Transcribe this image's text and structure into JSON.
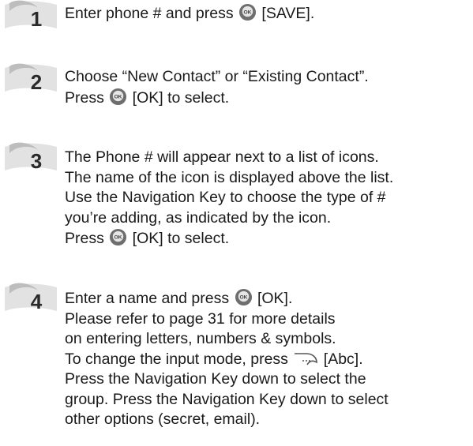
{
  "steps": [
    {
      "number": "1",
      "lines": [
        {
          "before": "Enter phone # and press ",
          "icon": "ok-button-icon",
          "after": " [SAVE]."
        }
      ]
    },
    {
      "number": "2",
      "lines": [
        {
          "text": "Choose “New Contact” or “Existing Contact”."
        },
        {
          "before": "Press ",
          "icon": "ok-button-icon",
          "after": " [OK] to select."
        }
      ]
    },
    {
      "number": "3",
      "lines": [
        {
          "text": "The Phone # will appear next to a list of icons."
        },
        {
          "text": "The name of the icon is displayed above the list."
        },
        {
          "text": "Use the Navigation Key to choose the type of #"
        },
        {
          "text": "you’re adding, as indicated by the icon."
        },
        {
          "before": "Press ",
          "icon": "ok-button-icon",
          "after": " [OK] to select."
        }
      ]
    },
    {
      "number": "4",
      "lines": [
        {
          "before": "Enter a name and press ",
          "icon": "ok-button-icon",
          "after": " [OK]."
        },
        {
          "text": "Please refer to page 31 for more details"
        },
        {
          "text": "on entering letters, numbers & symbols."
        },
        {
          "before": "To change the input mode, press ",
          "icon": "right-soft-key-icon",
          "after": " [Abc]."
        },
        {
          "text": "Press the Navigation Key down to select the"
        },
        {
          "text": "group. Press the Navigation Key down to select"
        },
        {
          "text": "other options (secret, email)."
        }
      ]
    }
  ],
  "colors": {
    "text": "#1a1a1a",
    "badge_dark": "#7a7a7a",
    "badge_light": "#e2e2e2",
    "ok_button": "#6e6e6e"
  }
}
